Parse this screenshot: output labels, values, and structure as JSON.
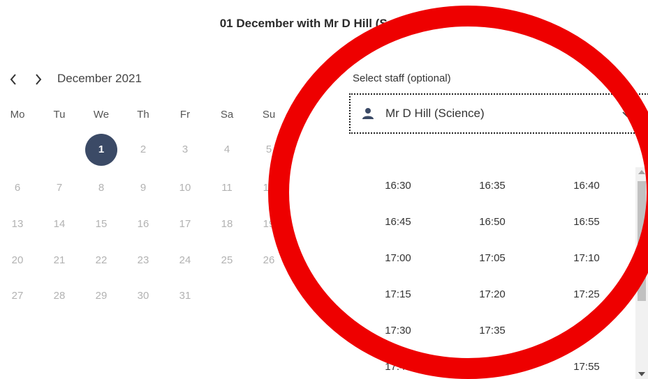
{
  "header": {
    "title": "01 December with Mr D Hill (Science)"
  },
  "calendar": {
    "prev_icon": "chevron-left-icon",
    "next_icon": "chevron-right-icon",
    "month_label": "December 2021",
    "weekdays": [
      "Mo",
      "Tu",
      "We",
      "Th",
      "Fr",
      "Sa",
      "Su"
    ],
    "selected_day": "1",
    "selected_color": "#3b4a66",
    "weeks": [
      [
        "",
        "",
        "1",
        "2",
        "3",
        "4",
        "5"
      ],
      [
        "6",
        "7",
        "8",
        "9",
        "10",
        "11",
        "12"
      ],
      [
        "13",
        "14",
        "15",
        "16",
        "17",
        "18",
        "19"
      ],
      [
        "20",
        "21",
        "22",
        "23",
        "24",
        "25",
        "26"
      ],
      [
        "27",
        "28",
        "29",
        "30",
        "31",
        "",
        ""
      ]
    ]
  },
  "staff": {
    "label": "Select staff (optional)",
    "selected": "Mr D Hill (Science)",
    "icon": "user-icon"
  },
  "slots": {
    "rows": [
      [
        "16:30",
        "16:35",
        "16:40"
      ],
      [
        "16:45",
        "16:50",
        "16:55"
      ],
      [
        "17:00",
        "17:05",
        "17:10"
      ],
      [
        "17:15",
        "17:20",
        "17:25"
      ],
      [
        "17:30",
        "17:35",
        "17:40"
      ],
      [
        "17:45",
        "17:50",
        "17:55"
      ]
    ]
  },
  "annotation": {
    "shape": "circle",
    "color": "#ee0000"
  }
}
